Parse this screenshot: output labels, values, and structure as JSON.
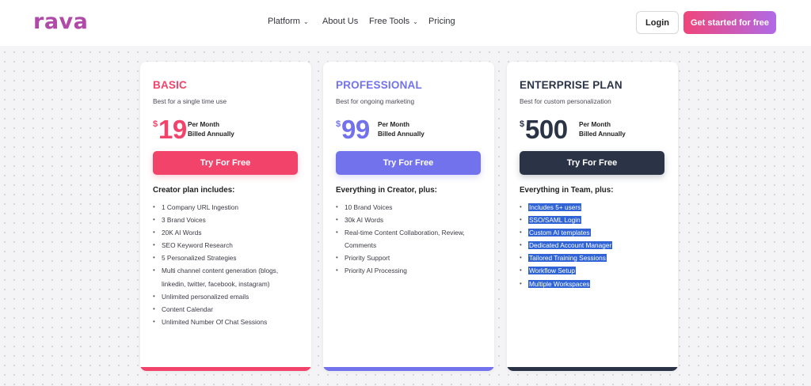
{
  "header": {
    "logo_text": "rava",
    "nav": [
      {
        "label": "Platform",
        "has_dropdown": true
      },
      {
        "label": "About Us",
        "has_dropdown": false
      },
      {
        "label": "Free Tools",
        "has_dropdown": true
      },
      {
        "label": "Pricing",
        "has_dropdown": false
      }
    ],
    "login_label": "Login",
    "cta_label": "Get started for free"
  },
  "plans": [
    {
      "name": "BASIC",
      "desc": "Best for a single time use",
      "currency": "$",
      "amount": "19",
      "per1": "Per Month",
      "per2": "Billed Annually",
      "button": "Try For Free",
      "includes": "Creator plan includes:",
      "accent": "#f2436a",
      "features": [
        "1 Company URL Ingestion",
        "3 Brand Voices",
        "20K AI Words",
        "SEO Keyword Research",
        "5 Personalized Strategies",
        "Multi channel content generation (blogs,",
        "linkedin, twitter, facebook, instagram)",
        "Unlimited personalized emails",
        "Content Calendar",
        "Unlimited Number Of Chat Sessions"
      ]
    },
    {
      "name": "PROFESSIONAL",
      "desc": "Best for ongoing marketing",
      "currency": "$",
      "amount": "99",
      "per1": "Per Month",
      "per2": "Billed Annually",
      "button": "Try For Free",
      "includes": "Everything in Creator, plus:",
      "accent": "#7272ec",
      "features": [
        "10 Brand Voices",
        "30k AI Words",
        "Real-time Content Collaboration, Review,",
        "Comments",
        "Priority Support",
        "Priority AI Processing"
      ]
    },
    {
      "name": "ENTERPRISE PLAN",
      "desc": "Best for custom personalization",
      "currency": "$",
      "amount": "500",
      "per1": "Per Month",
      "per2": "Billed Annually",
      "button": "Try For Free",
      "includes": "Everything in Team, plus:",
      "accent": "#2b3447",
      "features": [
        "Includes 5+ users",
        "SSO/SAML Login",
        "Custom AI templates",
        "Dedicated Account Manager",
        "Tailored Training Sessions",
        "Workflow Setup",
        "Multiple Workspaces"
      ]
    }
  ],
  "colors": {
    "logo": "#b04aa8",
    "basic": "#f2436a",
    "professional": "#7272ec",
    "enterprise": "#2b3447",
    "selection": "#2f63d6"
  }
}
